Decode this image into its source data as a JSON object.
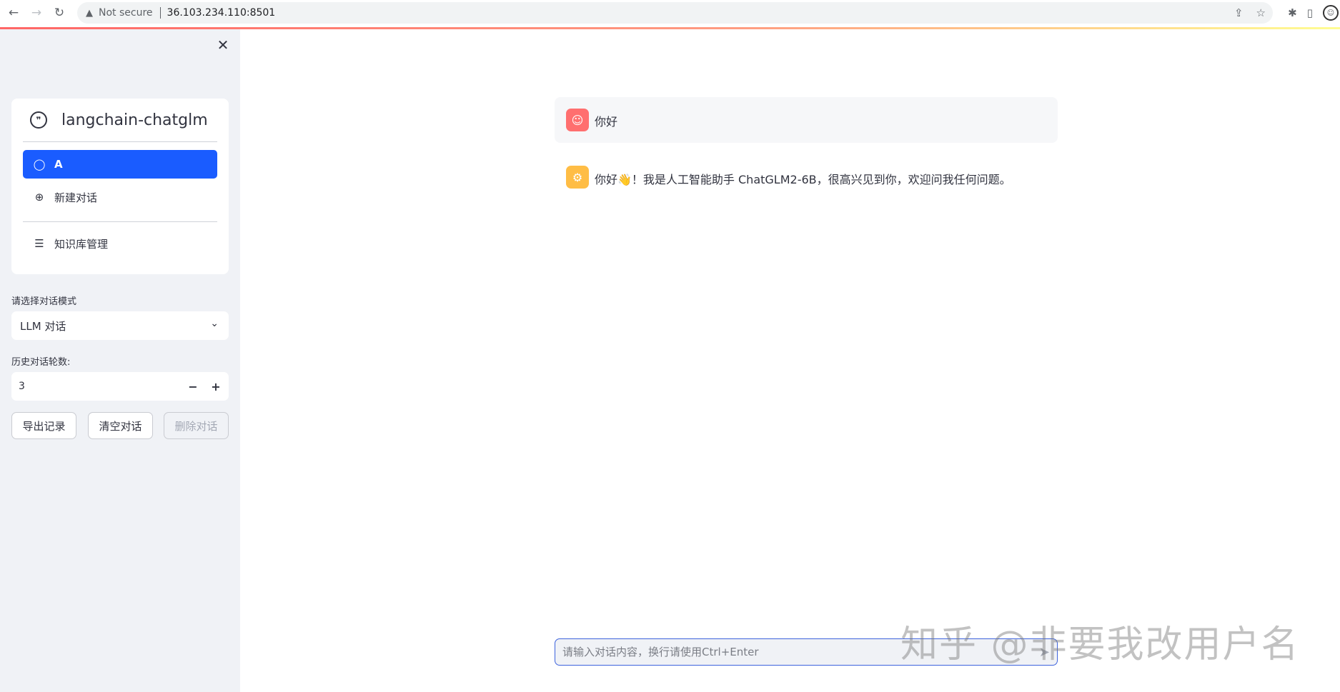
{
  "browser": {
    "security_label": "Not secure",
    "url": "36.103.234.110:8501"
  },
  "sidebar": {
    "app_title": "langchain-chatglm",
    "menu": {
      "active_item": "A",
      "new_chat": "新建对话",
      "knowledge_base": "知识库管理"
    },
    "mode": {
      "label": "请选择对话模式",
      "value": "LLM 对话"
    },
    "history": {
      "label": "历史对话轮数:",
      "value": "3",
      "minus": "−",
      "plus": "+"
    },
    "buttons": {
      "export": "导出记录",
      "clear": "清空对话",
      "delete": "删除对话"
    }
  },
  "chat": {
    "messages": [
      {
        "role": "user",
        "text": "你好"
      },
      {
        "role": "assistant",
        "text": "你好👋！我是人工智能助手 ChatGLM2-6B，很高兴见到你，欢迎问我任何问题。"
      }
    ],
    "input_placeholder": "请输入对话内容，换行请使用Ctrl+Enter"
  },
  "watermark": "知乎 @非要我改用户名",
  "colors": {
    "sidebar_bg": "#f0f2f6",
    "active_menu": "#1a5cff",
    "user_avatar": "#ff6f6f",
    "bot_avatar": "#ffbd45"
  }
}
